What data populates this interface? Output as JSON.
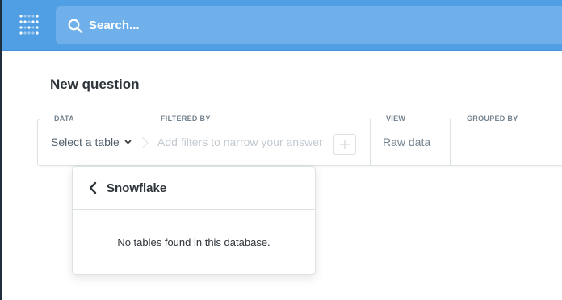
{
  "search": {
    "placeholder": "Search..."
  },
  "page": {
    "title": "New question"
  },
  "query_builder": {
    "data_label": "DATA",
    "data_value": "Select a table",
    "filtered_label": "FILTERED BY",
    "filter_placeholder": "Add filters to narrow your answer",
    "view_label": "VIEW",
    "view_value": "Raw data",
    "grouped_label": "GROUPED BY"
  },
  "table_picker": {
    "database_name": "Snowflake",
    "empty_message": "No tables found in this database."
  },
  "colors": {
    "nav_bg": "#509ee3",
    "search_bg": "#6fb0ea",
    "text_dark": "#2e353b",
    "text_muted": "#74838f",
    "border": "#dce1e4"
  }
}
